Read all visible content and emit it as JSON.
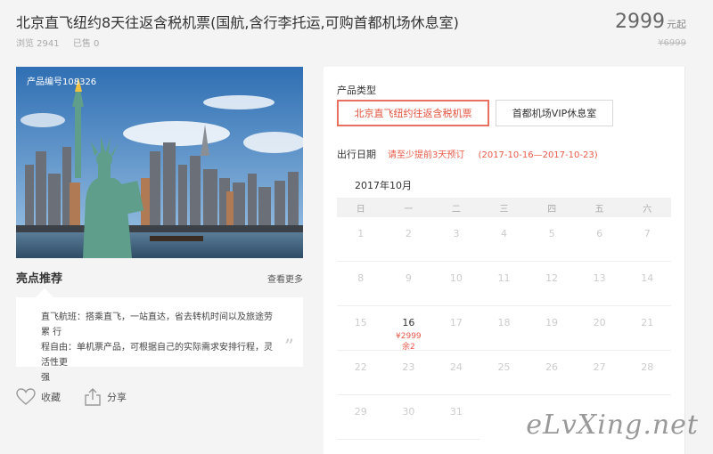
{
  "product": {
    "title": "北京直飞纽约8天往返含税机票(国航,含行李托运,可购首都机场休息室)",
    "views": "浏览 2941",
    "sold": "已售 0",
    "price": "2999",
    "price_unit": "元起",
    "original_price": "¥6999",
    "image_label": "产品编号108326"
  },
  "highlights": {
    "title": "亮点推荐",
    "more": "查看更多",
    "line1": "直飞航班：搭乘直飞，一站直达，省去转机时间以及旅途劳累 行",
    "line2": "程自由：单机票产品，可根据自己的实际需求安排行程，灵活性更",
    "line3": "强",
    "quote": "”"
  },
  "actions": {
    "favorite": "收藏",
    "share": "分享"
  },
  "booking": {
    "type_label": "产品类型",
    "types": [
      "北京直飞纽约往返含税机票",
      "首都机场VIP休息室"
    ],
    "date_label": "出行日期",
    "advance_note": "请至少提前3天预订",
    "date_range": "(2017-10-16—2017-10-23)",
    "month": "2017年10月",
    "weekdays": [
      "日",
      "一",
      "二",
      "三",
      "四",
      "五",
      "六"
    ],
    "days": [
      {
        "d": "1"
      },
      {
        "d": "2"
      },
      {
        "d": "3"
      },
      {
        "d": "4"
      },
      {
        "d": "5"
      },
      {
        "d": "6"
      },
      {
        "d": "7"
      },
      {
        "d": "8"
      },
      {
        "d": "9"
      },
      {
        "d": "10"
      },
      {
        "d": "11"
      },
      {
        "d": "12"
      },
      {
        "d": "13"
      },
      {
        "d": "14"
      },
      {
        "d": "15"
      },
      {
        "d": "16",
        "price": "¥2999",
        "stock": "余2"
      },
      {
        "d": "17"
      },
      {
        "d": "18"
      },
      {
        "d": "19"
      },
      {
        "d": "20"
      },
      {
        "d": "21"
      },
      {
        "d": "22"
      },
      {
        "d": "23"
      },
      {
        "d": "24"
      },
      {
        "d": "25"
      },
      {
        "d": "26"
      },
      {
        "d": "27"
      },
      {
        "d": "28"
      },
      {
        "d": "29"
      },
      {
        "d": "30"
      },
      {
        "d": "31"
      }
    ]
  },
  "watermark": "eLvXing.net"
}
